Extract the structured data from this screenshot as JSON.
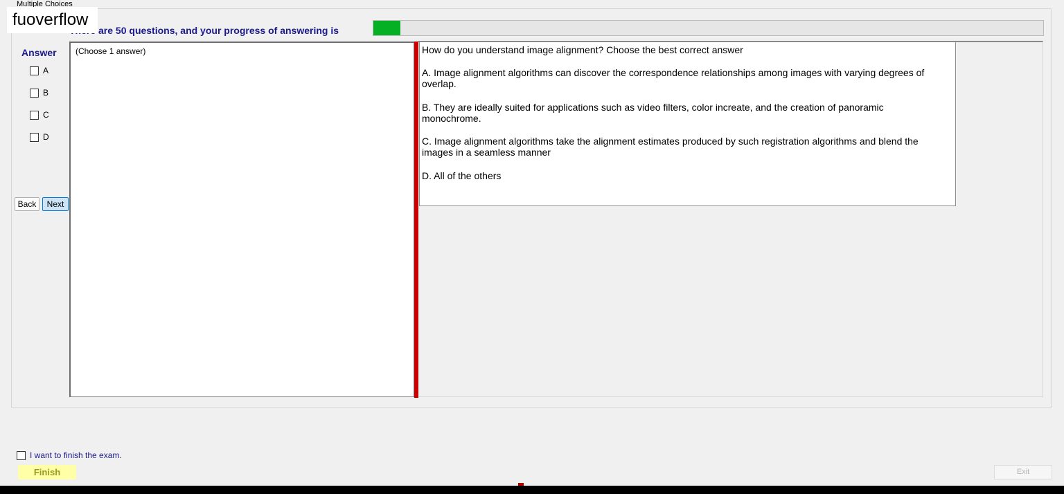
{
  "group": {
    "title": "Multiple Choices"
  },
  "logo": {
    "text": "fuoverflow"
  },
  "progress": {
    "label": "There are 50 questions, and your progress of answering is",
    "fraction": 0.04,
    "fill_color": "#06b025"
  },
  "answer_panel": {
    "title": "Answer",
    "options": [
      {
        "letter": "A",
        "checked": false
      },
      {
        "letter": "B",
        "checked": false
      },
      {
        "letter": "C",
        "checked": false
      },
      {
        "letter": "D",
        "checked": false
      }
    ],
    "back_label": "Back",
    "next_label": "Next"
  },
  "left_pane": {
    "hint": "(Choose 1 answer)"
  },
  "question": {
    "prompt": "How do you understand image alignment? Choose the best correct answer",
    "choices": [
      "A.  Image alignment algorithms can discover the correspondence relationships among images with varying degrees of overlap.",
      "B.  They are ideally suited for applications such as video filters, color increate, and the creation of panoramic monochrome.",
      "C.  Image alignment algorithms take the alignment estimates produced by such registration algorithms and blend the images in a seamless manner",
      "D.  All of the others"
    ]
  },
  "footer": {
    "finish_check_label": "I want to finish the exam.",
    "finish_label": "Finish",
    "exit_label": "Exit"
  },
  "colors": {
    "splitter": "#c70000",
    "heading_text": "#1a1a8c",
    "finish_bg": "#ffffa8"
  }
}
